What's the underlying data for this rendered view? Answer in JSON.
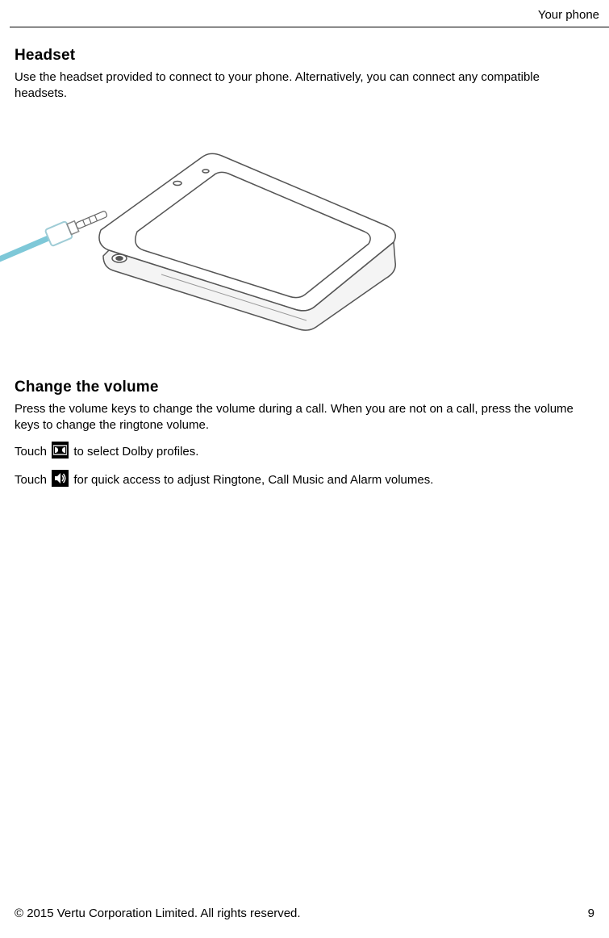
{
  "header": {
    "breadcrumb": "Your phone"
  },
  "sections": {
    "headset": {
      "title": "Headset",
      "body": "Use the headset provided to connect to your phone. Alternatively, you can connect any compatible headsets."
    },
    "volume": {
      "title": "Change the volume",
      "body": "Press the volume keys to change the volume during a call. When you are not on a call, press the volume keys to change the ringtone volume.",
      "touch1_prefix": "Touch ",
      "touch1_suffix": " to select Dolby profiles.",
      "touch2_prefix": "Touch ",
      "touch2_suffix": " for quick access to adjust Ringtone, Call Music and Alarm volumes."
    }
  },
  "footer": {
    "copyright": "© 2015 Vertu Corporation Limited. All rights reserved.",
    "page_number": "9"
  }
}
